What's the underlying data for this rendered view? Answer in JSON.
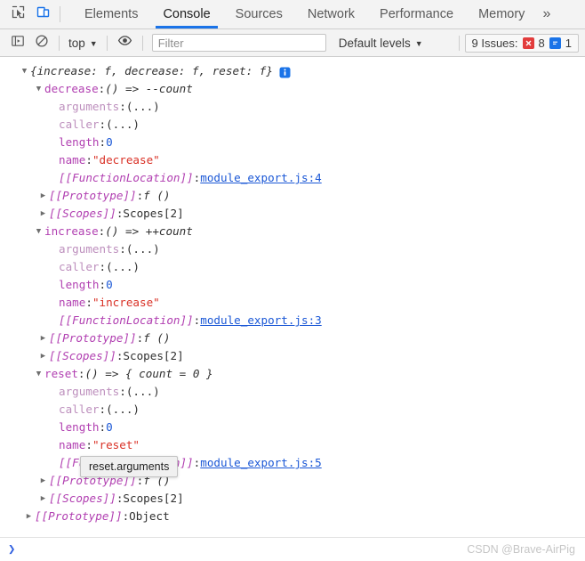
{
  "window": {
    "watermark": "CSDN @Brave-AirPig"
  },
  "tabbar": {
    "inspect_icon": "inspect-element-icon",
    "device_icon": "device-toolbar-icon",
    "tabs": [
      {
        "label": "Elements",
        "active": false
      },
      {
        "label": "Console",
        "active": true
      },
      {
        "label": "Sources",
        "active": false
      },
      {
        "label": "Network",
        "active": false
      },
      {
        "label": "Performance",
        "active": false
      },
      {
        "label": "Memory",
        "active": false
      }
    ],
    "more_label": "»"
  },
  "console_toolbar": {
    "sidebar_icon": "show-console-sidebar-icon",
    "clear_icon": "clear-console-icon",
    "context": {
      "value": "top",
      "caret": "▼"
    },
    "eye_icon": "live-expression-icon",
    "filter": {
      "value": "",
      "placeholder": "Filter"
    },
    "levels": {
      "label": "Default levels",
      "caret": "▼"
    },
    "issues": {
      "label": "9 Issues:",
      "error_count": "8",
      "info_count": "1",
      "error_color": "#e23c3c",
      "info_color": "#1a73e8"
    }
  },
  "console_output": {
    "object_preview": {
      "triangle": "▼",
      "text": "{increase: f, decrease: f, reset: f}",
      "info_icon": "info-circle-icon"
    },
    "entries": [
      {
        "triangle": "▼",
        "name": "decrease",
        "sep": ": ",
        "value": "() => --count"
      },
      {
        "triangle": "",
        "name": "arguments",
        "sep": ": ",
        "value": "(...)"
      },
      {
        "triangle": "",
        "name": "caller",
        "sep": ": ",
        "value": "(...)"
      },
      {
        "triangle": "",
        "name": "length",
        "sep": ": ",
        "value": "0"
      },
      {
        "triangle": "",
        "name": "name",
        "sep": ": ",
        "value": "\"decrease\""
      },
      {
        "triangle": "",
        "name": "[[FunctionLocation]]",
        "sep": ": ",
        "value": "module_export.js:4"
      },
      {
        "triangle": "▶",
        "name": "[[Prototype]]",
        "sep": ": ",
        "value": "f ()"
      },
      {
        "triangle": "▶",
        "name": "[[Scopes]]",
        "sep": ": ",
        "value": "Scopes[2]"
      },
      {
        "triangle": "▼",
        "name": "increase",
        "sep": ": ",
        "value": "() => ++count"
      },
      {
        "triangle": "",
        "name": "arguments",
        "sep": ": ",
        "value": "(...)"
      },
      {
        "triangle": "",
        "name": "caller",
        "sep": ": ",
        "value": "(...)"
      },
      {
        "triangle": "",
        "name": "length",
        "sep": ": ",
        "value": "0"
      },
      {
        "triangle": "",
        "name": "name",
        "sep": ": ",
        "value": "\"increase\""
      },
      {
        "triangle": "",
        "name": "[[FunctionLocation]]",
        "sep": ": ",
        "value": "module_export.js:3"
      },
      {
        "triangle": "▶",
        "name": "[[Prototype]]",
        "sep": ": ",
        "value": "f ()"
      },
      {
        "triangle": "▶",
        "name": "[[Scopes]]",
        "sep": ": ",
        "value": "Scopes[2]"
      },
      {
        "triangle": "▼",
        "name": "reset",
        "sep": ": ",
        "value": "() => { count = 0 }"
      },
      {
        "triangle": "",
        "name": "arguments",
        "sep": ": ",
        "value": "(...)"
      },
      {
        "triangle": "",
        "name": "caller",
        "sep": ": ",
        "value": "(...)"
      },
      {
        "triangle": "",
        "name": "length",
        "sep": ": ",
        "value": "0"
      },
      {
        "triangle": "",
        "name": "name",
        "sep": ": ",
        "value": "\"reset\""
      },
      {
        "triangle": "",
        "name": "[[FunctionLocation]]",
        "sep": ": ",
        "value": "module_export.js:5"
      },
      {
        "triangle": "▶",
        "name": "[[Prototype]]",
        "sep": ": ",
        "value": "f ()"
      },
      {
        "triangle": "▶",
        "name": "[[Scopes]]",
        "sep": ": ",
        "value": "Scopes[2]"
      }
    ],
    "root_prototype": {
      "triangle": "▶",
      "name": "[[Prototype]]",
      "sep": ": ",
      "value": "Object"
    }
  },
  "tooltip": {
    "text": "reset.arguments"
  },
  "prompt": {
    "chevron": "❯",
    "value": ""
  },
  "labels": {
    "colon": ": "
  }
}
